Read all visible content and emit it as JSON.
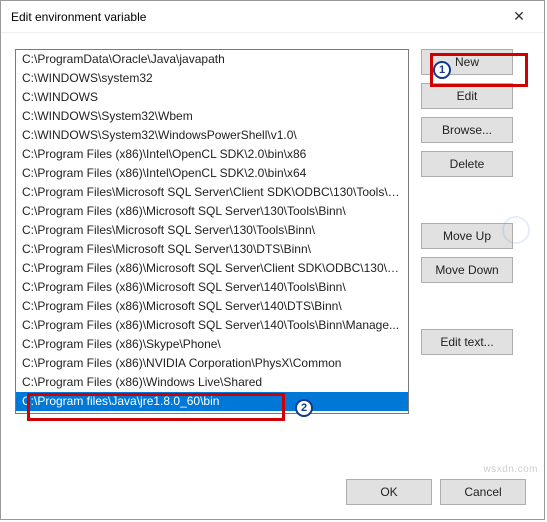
{
  "dialog": {
    "title": "Edit environment variable",
    "close_glyph": "✕"
  },
  "paths": [
    "C:\\ProgramData\\Oracle\\Java\\javapath",
    "C:\\WINDOWS\\system32",
    "C:\\WINDOWS",
    "C:\\WINDOWS\\System32\\Wbem",
    "C:\\WINDOWS\\System32\\WindowsPowerShell\\v1.0\\",
    "C:\\Program Files (x86)\\Intel\\OpenCL SDK\\2.0\\bin\\x86",
    "C:\\Program Files (x86)\\Intel\\OpenCL SDK\\2.0\\bin\\x64",
    "C:\\Program Files\\Microsoft SQL Server\\Client SDK\\ODBC\\130\\Tools\\Bin...",
    "C:\\Program Files (x86)\\Microsoft SQL Server\\130\\Tools\\Binn\\",
    "C:\\Program Files\\Microsoft SQL Server\\130\\Tools\\Binn\\",
    "C:\\Program Files\\Microsoft SQL Server\\130\\DTS\\Binn\\",
    "C:\\Program Files (x86)\\Microsoft SQL Server\\Client SDK\\ODBC\\130\\Tool...",
    "C:\\Program Files (x86)\\Microsoft SQL Server\\140\\Tools\\Binn\\",
    "C:\\Program Files (x86)\\Microsoft SQL Server\\140\\DTS\\Binn\\",
    "C:\\Program Files (x86)\\Microsoft SQL Server\\140\\Tools\\Binn\\Manage...",
    "C:\\Program Files (x86)\\Skype\\Phone\\",
    "C:\\Program Files (x86)\\NVIDIA Corporation\\PhysX\\Common",
    "C:\\Program Files (x86)\\Windows Live\\Shared",
    "C:\\Program files\\Java\\jre1.8.0_60\\bin"
  ],
  "selected_index": 18,
  "buttons": {
    "new": "New",
    "edit": "Edit",
    "browse": "Browse...",
    "delete": "Delete",
    "moveup": "Move Up",
    "movedown": "Move Down",
    "edittext": "Edit text...",
    "ok": "OK",
    "cancel": "Cancel"
  },
  "markers": {
    "one": "1",
    "two": "2"
  },
  "watermark": "wsxdn.com"
}
